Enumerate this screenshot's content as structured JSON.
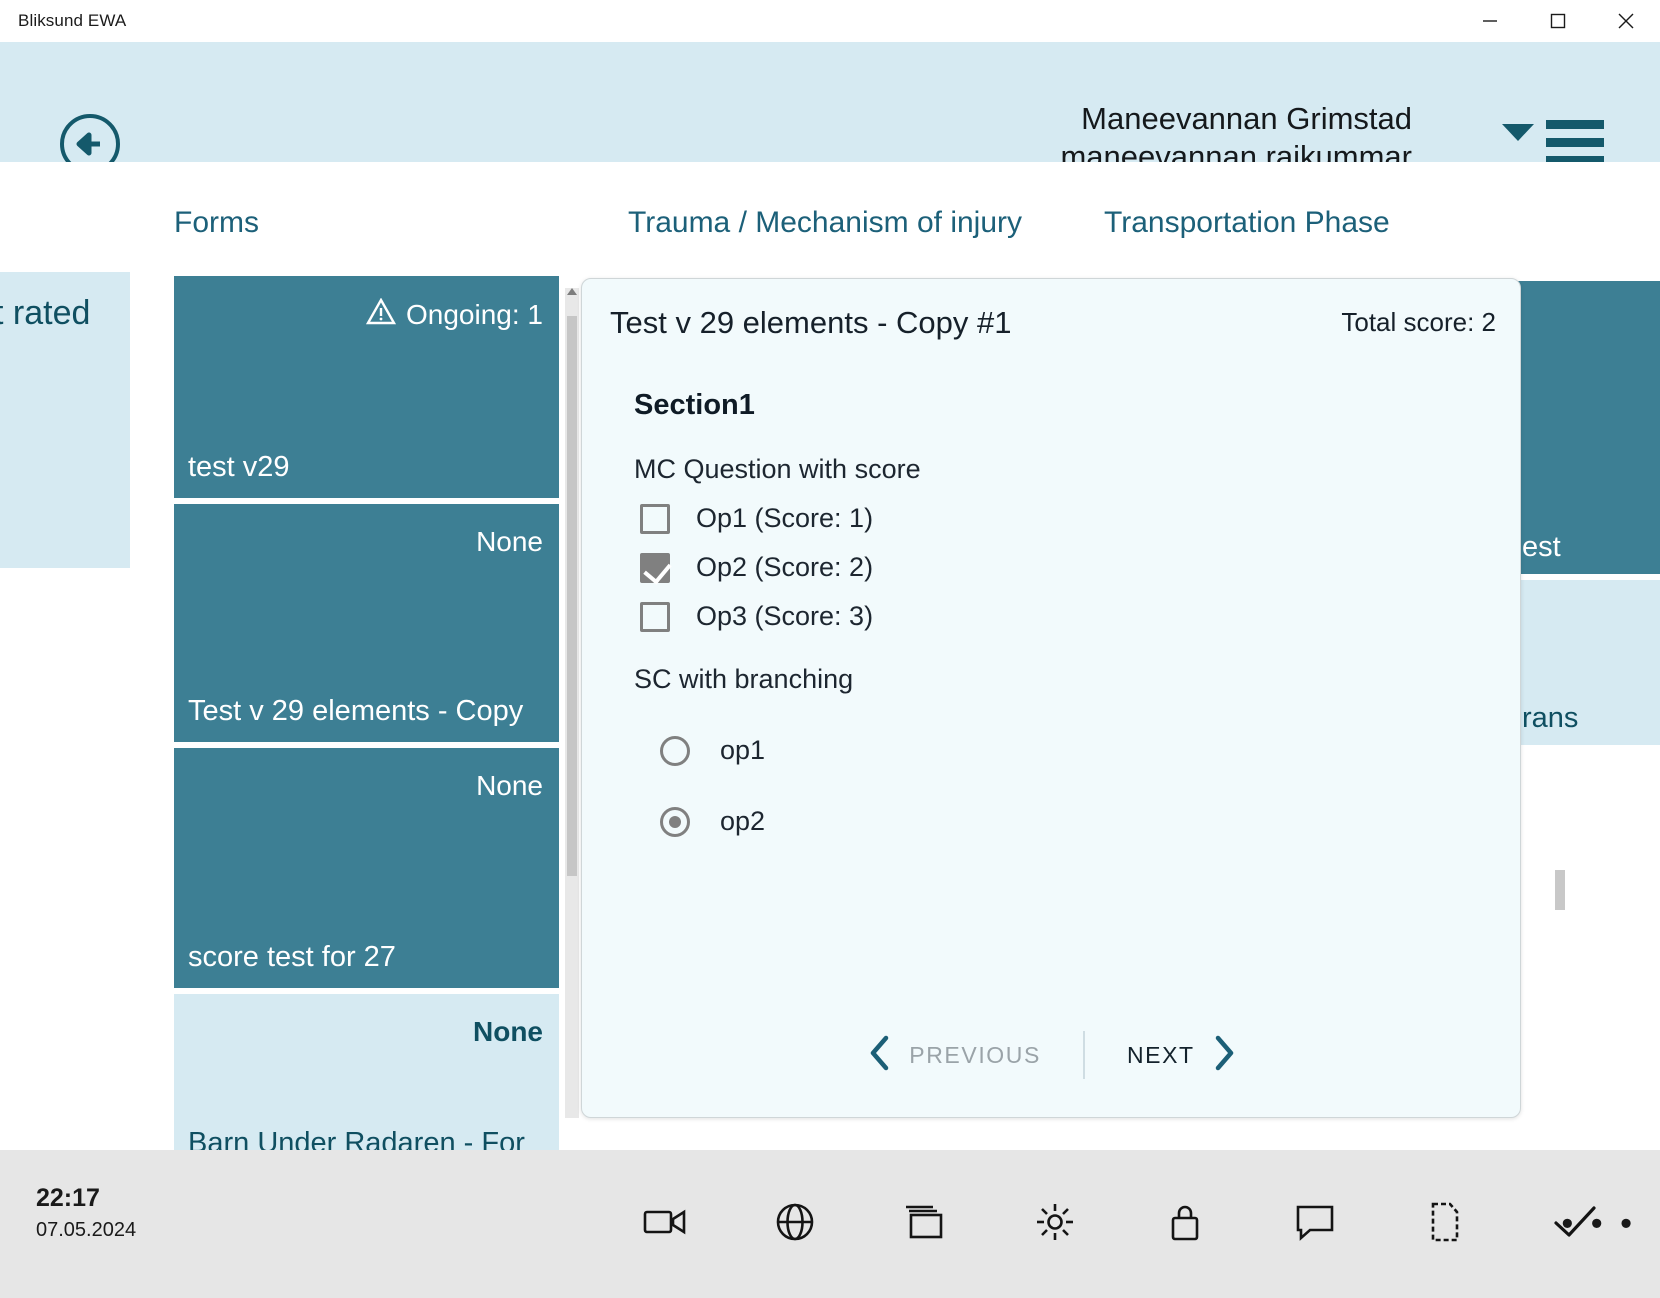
{
  "window": {
    "title": "Bliksund EWA",
    "controls": [
      {
        "name": "minimize",
        "glyph": "minimize-icon"
      },
      {
        "name": "maximize",
        "glyph": "maximize-icon"
      },
      {
        "name": "close",
        "glyph": "close-icon"
      }
    ]
  },
  "header": {
    "back_icon": "back-arrow-icon",
    "user_name": "Maneevannan Grimstad",
    "user_login": "maneevannan.rajkummar",
    "caret_icon": "chevron-down-icon",
    "menu_icon": "hamburger-menu-icon",
    "background_color": "#d6eaf2",
    "accent_color": "#14596b"
  },
  "tabs": [
    {
      "label": "Forms",
      "active": false
    },
    {
      "label": "Trauma / Mechanism of injury",
      "active": true
    },
    {
      "label": "Transportation Phase",
      "active": false
    }
  ],
  "left_panel": {
    "clipped_text": "t rated",
    "background_color": "#d6eaf2"
  },
  "form_cards": [
    {
      "status": "Ongoing: 1",
      "has_warning": true,
      "title": "test v29",
      "selected": true
    },
    {
      "status": "None",
      "has_warning": false,
      "title": "Test v 29 elements - Copy",
      "selected": true
    },
    {
      "status": "None",
      "has_warning": false,
      "title": "score test for 27",
      "selected": true
    },
    {
      "status": "None",
      "has_warning": false,
      "title": "Barn Under Radaren - For",
      "selected": false
    }
  ],
  "right_partial_cards": [
    {
      "title": "est",
      "selected": true
    },
    {
      "title": "rans",
      "selected": false
    }
  ],
  "dialog": {
    "title": "Test v 29 elements - Copy #1",
    "total_score_label": "Total score: 2",
    "section_title": "Section1",
    "questions": [
      {
        "label": "MC Question with score",
        "type": "checkbox",
        "options": [
          {
            "text": "Op1 (Score: 1)",
            "checked": false
          },
          {
            "text": "Op2 (Score: 2)",
            "checked": true
          },
          {
            "text": "Op3 (Score: 3)",
            "checked": false
          }
        ]
      },
      {
        "label": "SC with branching",
        "type": "radio",
        "options": [
          {
            "text": "op1",
            "checked": false
          },
          {
            "text": "op2",
            "checked": true
          }
        ]
      }
    ],
    "nav": {
      "previous_label": "PREVIOUS",
      "previous_enabled": false,
      "previous_icon": "chevron-left-icon",
      "next_label": "NEXT",
      "next_enabled": true,
      "next_icon": "chevron-right-icon"
    },
    "background_color": "#f2fafc"
  },
  "taskbar": {
    "time": "22:17",
    "date": "07.05.2024",
    "icons": [
      "video-camera-icon",
      "globe-icon",
      "task-view-icon",
      "gear-icon",
      "lock-icon",
      "chat-bubble-icon",
      "document-icon",
      "checkmark-icon"
    ],
    "overflow_label": "• • •",
    "background_color": "#e6e6e6"
  }
}
